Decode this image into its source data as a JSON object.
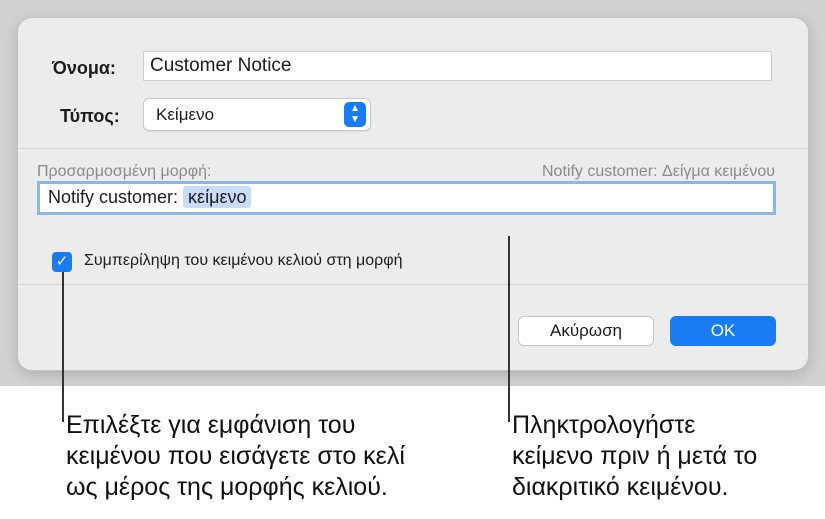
{
  "dialog": {
    "name_label": "Όνομα:",
    "name_value": "Customer Notice",
    "type_label": "Τύπος:",
    "type_value": "Κείμενο",
    "custom_format_label": "Προσαρμοσμένη μορφή:",
    "sample_preview": "Notify customer: Δείγμα κειμένου",
    "format_prefix": "Notify customer: ",
    "format_token": "κείμενο",
    "checkbox_label": "Συμπερίληψη του κειμένου κελιού στη μορφή",
    "cancel_label": "Ακύρωση",
    "ok_label": "OK",
    "accent_color": "#1a7cf5"
  },
  "callouts": {
    "left": [
      "Επιλέξτε για εμφάνιση του",
      "κειμένου που εισάγετε στο κελί",
      "ως μέρος της μορφής κελιού."
    ],
    "right": [
      "Πληκτρολογήστε",
      "κείμενο πριν ή μετά το",
      "διακριτικό κειμένου."
    ]
  }
}
